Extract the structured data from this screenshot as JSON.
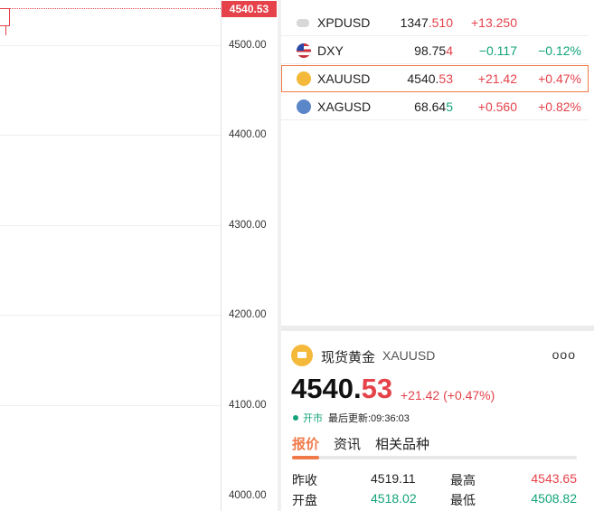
{
  "chart": {
    "last_price_tag": "4540.53",
    "y_labels": [
      "4500.00",
      "4400.00",
      "4300.00",
      "4200.00",
      "4100.00",
      "4000.00"
    ]
  },
  "watchlist": {
    "rows": [
      {
        "symbol": "XPDUSD",
        "price_main": "1347",
        "price_tail": ".510",
        "change": "+13.250",
        "pct": "",
        "icon": "palladium-icon",
        "up": true
      },
      {
        "symbol": "DXY",
        "price_main": "98.75",
        "price_tail": "4",
        "change": "−0.117",
        "pct": "−0.12%",
        "icon": "us-flag-icon",
        "up": false
      },
      {
        "symbol": "XAUUSD",
        "price_main": "4540.",
        "price_tail": "53",
        "change": "+21.42",
        "pct": "+0.47%",
        "icon": "gold-icon",
        "up": true
      },
      {
        "symbol": "XAGUSD",
        "price_main": "68.64",
        "price_tail": "5",
        "change": "+0.560",
        "pct": "+0.82%",
        "icon": "silver-icon",
        "up": true
      }
    ]
  },
  "detail": {
    "name": "现货黄金",
    "code": "XAUUSD",
    "more": "ooo",
    "price_int": "4540.",
    "price_dec": "53",
    "change": "+21.42 (+0.47%)",
    "status_open": "开市",
    "status_update": "最后更新:09:36:03",
    "tabs": [
      "报价",
      "资讯",
      "相关品种"
    ],
    "stats": {
      "prev_close_label": "昨收",
      "prev_close": "4519.11",
      "high_label": "最高",
      "high": "4543.65",
      "open_label": "开盘",
      "open": "4518.02",
      "low_label": "最低",
      "low": "4508.82"
    }
  },
  "colors": {
    "up": "#e5424a",
    "down": "#12a37a",
    "accent": "#f07a4a",
    "gold": "#f4b93a"
  }
}
